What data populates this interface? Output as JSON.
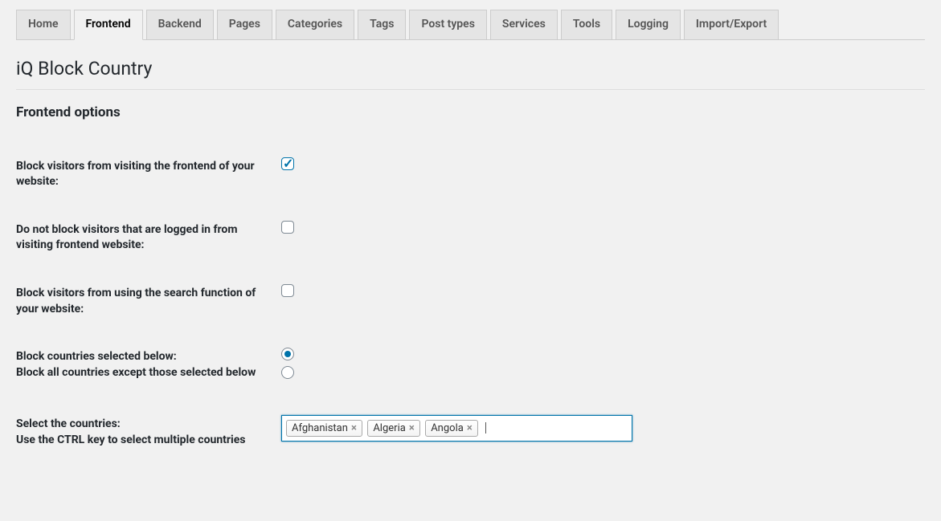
{
  "tabs": [
    {
      "label": "Home",
      "active": false
    },
    {
      "label": "Frontend",
      "active": true
    },
    {
      "label": "Backend",
      "active": false
    },
    {
      "label": "Pages",
      "active": false
    },
    {
      "label": "Categories",
      "active": false
    },
    {
      "label": "Tags",
      "active": false
    },
    {
      "label": "Post types",
      "active": false
    },
    {
      "label": "Services",
      "active": false
    },
    {
      "label": "Tools",
      "active": false
    },
    {
      "label": "Logging",
      "active": false
    },
    {
      "label": "Import/Export",
      "active": false
    }
  ],
  "page_title": "iQ Block Country",
  "section_title": "Frontend options",
  "options": {
    "block_frontend": {
      "label": "Block visitors from visiting the frontend of your website:",
      "checked": true
    },
    "no_block_loggedin": {
      "label": "Do not block visitors that are logged in from visiting frontend website:",
      "checked": false
    },
    "block_search": {
      "label": "Block visitors from using the search function of your website:",
      "checked": false
    },
    "block_mode": {
      "label_line1": "Block countries selected below:",
      "label_line2": "Block all countries except those selected below",
      "selected": 0
    },
    "select_countries": {
      "label_line1": "Select the countries:",
      "label_line2": "Use the CTRL key to select multiple countries",
      "selected": [
        "Afghanistan",
        "Algeria",
        "Angola"
      ]
    }
  }
}
